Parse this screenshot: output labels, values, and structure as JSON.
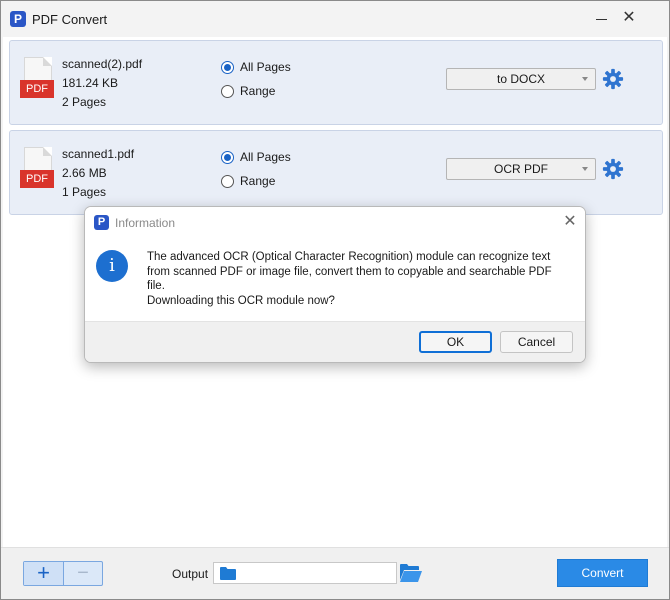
{
  "window": {
    "title": "PDF Convert",
    "app_logo_letter": "P"
  },
  "files": [
    {
      "name": "scanned(2).pdf",
      "size": "181.24 KB",
      "pages": "2 Pages",
      "icon_label": "PDF",
      "radio_all": "All Pages",
      "radio_range": "Range",
      "selected_range": "All Pages",
      "format": "to DOCX"
    },
    {
      "name": "scanned1.pdf",
      "size": "2.66 MB",
      "pages": "1 Pages",
      "icon_label": "PDF",
      "radio_all": "All Pages",
      "radio_range": "Range",
      "selected_range": "All Pages",
      "format": "OCR PDF"
    }
  ],
  "bottom": {
    "add_symbol": "+",
    "remove_symbol": "−",
    "output_label": "Output",
    "output_path": "",
    "convert_label": "Convert"
  },
  "dialog": {
    "title": "Information",
    "logo_letter": "P",
    "icon_symbol": "i",
    "message_lines": [
      "The advanced OCR (Optical Character Recognition) module can recognize text",
      "from scanned PDF or image file, convert them to copyable and searchable PDF",
      "file.",
      "Downloading this OCR module now?"
    ],
    "ok_label": "OK",
    "cancel_label": "Cancel"
  },
  "icons": {
    "app": "app-logo-icon",
    "minimize": "minimize-icon",
    "close": "close-icon",
    "file": "pdf-file-icon",
    "settings": "gear-icon",
    "folder": "folder-icon",
    "browse": "open-folder-icon",
    "info": "info-icon"
  },
  "colors": {
    "accent": "#1a63c5",
    "convert_button": "#2a8ae6",
    "pdf_badge": "#d9342b",
    "row_background": "#e9eef7",
    "gear": "#2f74d0"
  }
}
